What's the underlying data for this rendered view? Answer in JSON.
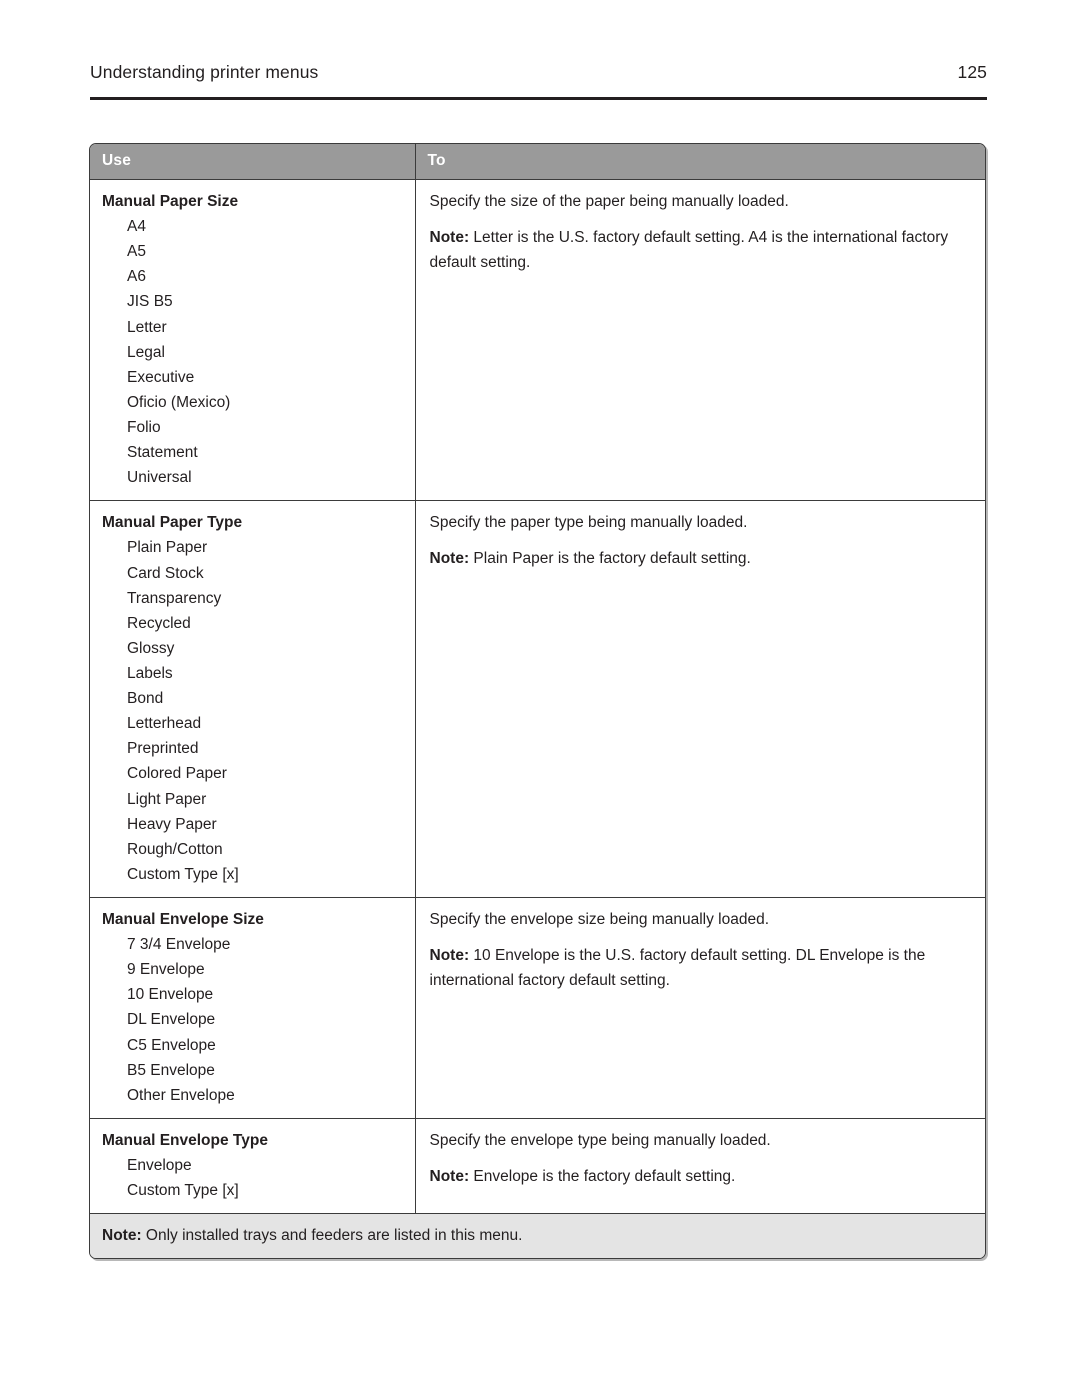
{
  "header": {
    "chapter_title": "Understanding printer menus",
    "page_number": "125"
  },
  "table": {
    "columns": {
      "use": "Use",
      "to": "To"
    },
    "rows": [
      {
        "setting": "Manual Paper Size",
        "options": [
          "A4",
          "A5",
          "A6",
          "JIS B5",
          "Letter",
          "Legal",
          "Executive",
          "Oficio (Mexico)",
          "Folio",
          "Statement",
          "Universal"
        ],
        "description": "Specify the size of the paper being manually loaded.",
        "note_label": "Note:",
        "note_text": " Letter is the U.S. factory default setting. A4 is the international factory default setting."
      },
      {
        "setting": "Manual Paper Type",
        "options": [
          "Plain Paper",
          "Card Stock",
          "Transparency",
          "Recycled",
          "Glossy",
          "Labels",
          "Bond",
          "Letterhead",
          "Preprinted",
          "Colored Paper",
          "Light Paper",
          "Heavy Paper",
          "Rough/Cotton",
          "Custom Type [x]"
        ],
        "description": "Specify the paper type being manually loaded.",
        "note_label": "Note:",
        "note_text": " Plain Paper is the factory default setting."
      },
      {
        "setting": "Manual Envelope Size",
        "options": [
          "7 3/4 Envelope",
          "9 Envelope",
          "10 Envelope",
          "DL Envelope",
          "C5 Envelope",
          "B5 Envelope",
          "Other Envelope"
        ],
        "description": "Specify the envelope size being manually loaded.",
        "note_label": "Note:",
        "note_text": " 10 Envelope is the U.S. factory default setting. DL Envelope is the international factory default setting."
      },
      {
        "setting": "Manual Envelope Type",
        "options": [
          "Envelope",
          "Custom Type [x]"
        ],
        "description": "Specify the envelope type being manually loaded.",
        "note_label": "Note:",
        "note_text": " Envelope is the factory default setting."
      }
    ],
    "footnote": {
      "label": "Note:",
      "text": " Only installed trays and feeders are listed in this menu."
    }
  },
  "colors": {
    "header_band": "#9a9a9a",
    "footnote_band": "#e4e4e4",
    "rule": "#231f20",
    "text": "#231f20"
  }
}
